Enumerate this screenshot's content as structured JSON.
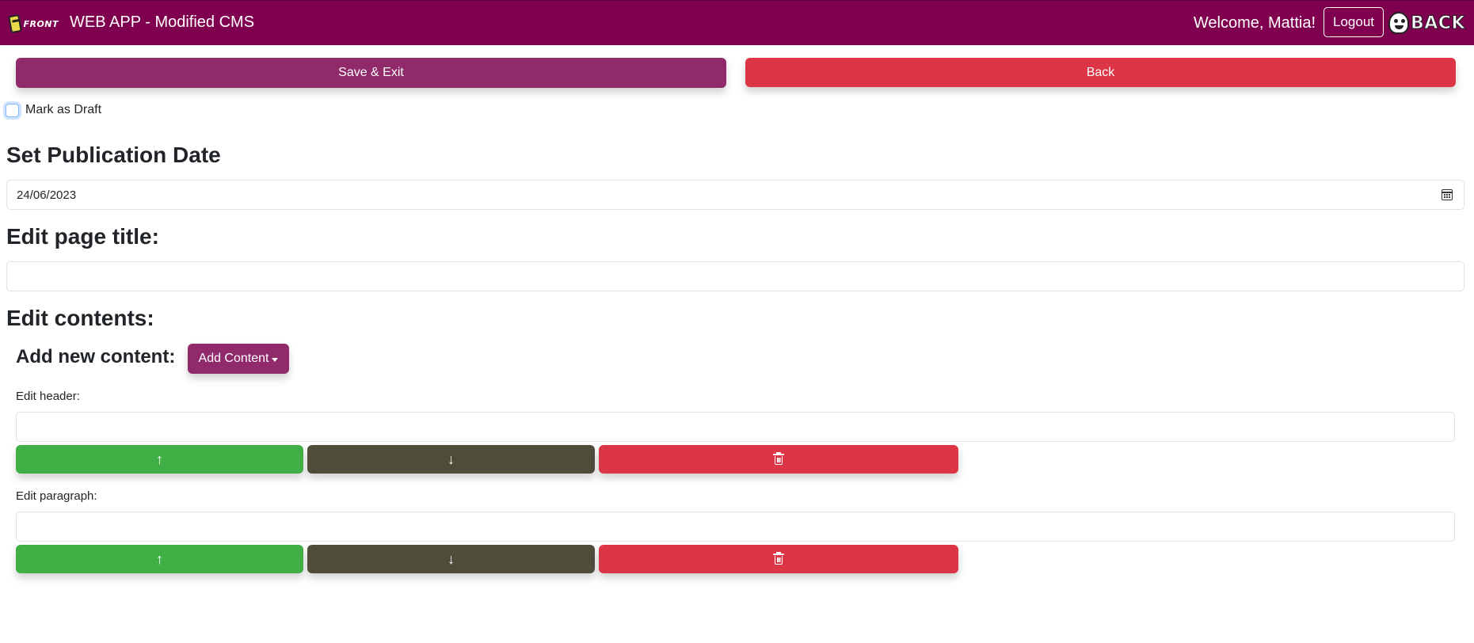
{
  "navbar": {
    "brand_logo_text": "FRONT",
    "app_title": "WEB APP - Modified CMS",
    "welcome": "Welcome, Mattia!",
    "logout_label": "Logout",
    "back_logo_text": "BACK",
    "background_color": "#800050"
  },
  "actions": {
    "save_label": "Save & Exit",
    "back_label": "Back"
  },
  "draft": {
    "label": "Mark as Draft",
    "checked": false
  },
  "publication": {
    "heading": "Set Publication Date",
    "date_value": "24/06/2023"
  },
  "page_title": {
    "heading": "Edit page title:",
    "value": ""
  },
  "contents": {
    "heading": "Edit contents:",
    "add_heading": "Add new content:",
    "add_button_label": "Add Content",
    "blocks": [
      {
        "label": "Edit header:",
        "value": "",
        "up": "↑",
        "down": "↓",
        "delete_icon": "trash-icon"
      },
      {
        "label": "Edit paragraph:",
        "value": "",
        "up": "↑",
        "down": "↓",
        "delete_icon": "trash-icon"
      }
    ]
  },
  "colors": {
    "primary": "#912a6b",
    "danger": "#dc3545",
    "success": "#40b046",
    "dark": "#4f4d3a"
  }
}
